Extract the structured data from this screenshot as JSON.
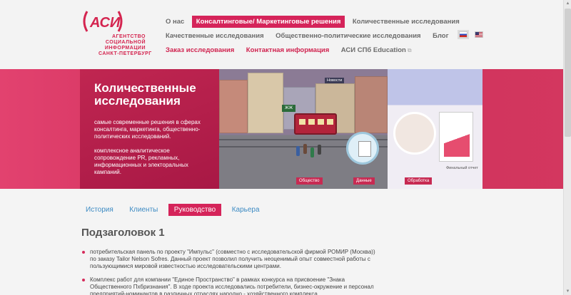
{
  "logo": {
    "mark": "(АСИ)",
    "lines": [
      "АГЕНТСТВО",
      "СОЦИАЛЬНОЙ",
      "ИНФОРМАЦИИ",
      "САНКТ-ПЕТЕРБУРГ"
    ]
  },
  "nav": {
    "row1": [
      {
        "label": "О нас",
        "style": "normal"
      },
      {
        "label": "Консалтинговые/ Маркетинговые решения",
        "style": "active"
      },
      {
        "label": "Количественные исследования",
        "style": "normal"
      }
    ],
    "row2": [
      {
        "label": "Качественные исследования",
        "style": "normal"
      },
      {
        "label": "Общественно-политические исследования",
        "style": "normal"
      },
      {
        "label": "Блог",
        "style": "normal"
      }
    ],
    "row3": [
      {
        "label": "Заказ исследования",
        "style": "pink"
      },
      {
        "label": "Контактная информация",
        "style": "pink"
      },
      {
        "label": "АСИ СПб Education",
        "style": "normal"
      }
    ],
    "ext_icon": "external-link-icon"
  },
  "languages": [
    "ru",
    "en"
  ],
  "banner": {
    "title": "Количественные исследования",
    "paragraphs": [
      "самые современные решения в сферах консалтинга, маркетинга, общественно-политических исследований.",
      "комплексное аналитическое сопровождение PR, рекламных, информационных и электоральных кампаний."
    ],
    "scene": {
      "sign": "Новости",
      "tram_label": "ЖЖ",
      "labels": [
        "Общество",
        "Данные",
        "Обработка"
      ],
      "report_label": "Финальный отчет"
    }
  },
  "tabs": [
    {
      "label": "История",
      "active": false
    },
    {
      "label": "Клиенты",
      "active": false
    },
    {
      "label": "Руководство",
      "active": true
    },
    {
      "label": "Карьера",
      "active": false
    }
  ],
  "content": {
    "subheading": "Подзаголовок 1",
    "bullets": [
      "потребительская панель по проекту \"Импульс\" (совместно с исследовательской фирмой РОМИР (Москва)) по заказу Tailor Nelson Sofres. Данный проект позволил получить неоценимый опыт совместной работы с пользующимися мировой известностью исследовательскими центрами.",
      "Комплекс работ для компании \"Единое Пространство\" в рамках конкурса на присвоение \"Знака Общественного Пхбризнания\". В ходе проекта исследовались потребители, бизнес-окружение и персонал предприятий-номинантов в различных отраслях народно - хозяйственного комплекса"
    ]
  },
  "colors": {
    "accent": "#d5245a",
    "link": "#3d8bc3",
    "nav_text": "#6b6b6b"
  }
}
